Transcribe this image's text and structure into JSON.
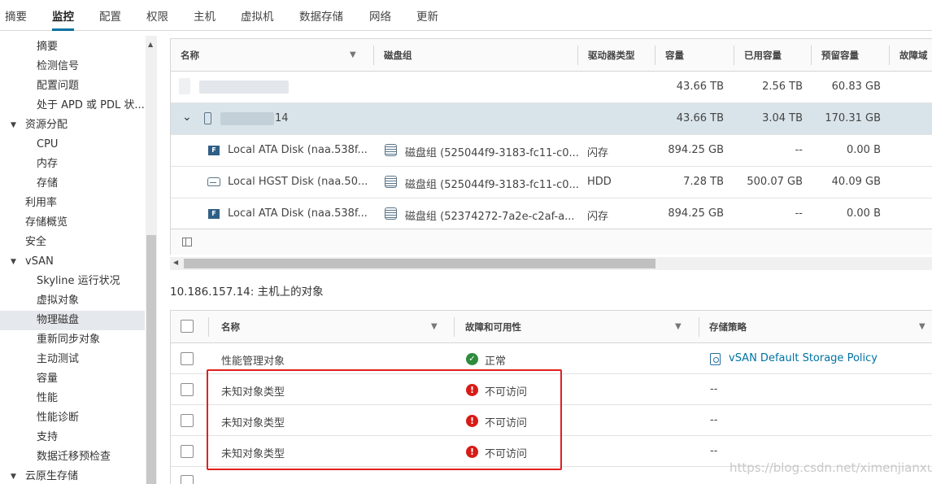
{
  "tabs": [
    "摘要",
    "监控",
    "配置",
    "权限",
    "主机",
    "虚拟机",
    "数据存储",
    "网络",
    "更新"
  ],
  "active_tab": "监控",
  "nav": {
    "items": [
      {
        "label": "摘要"
      },
      {
        "label": "检测信号"
      },
      {
        "label": "配置问题"
      },
      {
        "label": "处于 APD 或 PDL 状..."
      },
      {
        "label": "资源分配"
      },
      {
        "label": "CPU"
      },
      {
        "label": "内存"
      },
      {
        "label": "存储"
      },
      {
        "label": "利用率"
      },
      {
        "label": "存储概览"
      },
      {
        "label": "安全"
      },
      {
        "label": "vSAN"
      },
      {
        "label": "Skyline 运行状况"
      },
      {
        "label": "虚拟对象"
      },
      {
        "label": "物理磁盘"
      },
      {
        "label": "重新同步对象"
      },
      {
        "label": "主动测试"
      },
      {
        "label": "容量"
      },
      {
        "label": "性能"
      },
      {
        "label": "性能诊断"
      },
      {
        "label": "支持"
      },
      {
        "label": "数据迁移预检查"
      },
      {
        "label": "云原生存储"
      }
    ],
    "selected": "物理磁盘"
  },
  "disk_grid": {
    "headers": [
      "名称",
      "磁盘组",
      "驱动器类型",
      "容量",
      "已用容量",
      "预留容量",
      "故障域"
    ],
    "rows": [
      {
        "name": "",
        "group": "",
        "type": "",
        "capacity": "43.66 TB",
        "used": "2.56 TB",
        "reserved": "60.83 GB"
      },
      {
        "name": "14",
        "group": "",
        "type": "",
        "capacity": "43.66 TB",
        "used": "3.04 TB",
        "reserved": "170.31 GB"
      },
      {
        "name": "Local ATA Disk (naa.538f...",
        "group": "磁盘组 (525044f9-3183-fc11-c0...",
        "type": "闪存",
        "capacity": "894.25 GB",
        "used": "--",
        "reserved": "0.00 B",
        "icon": "F"
      },
      {
        "name": "Local HGST Disk (naa.50...",
        "group": "磁盘组 (525044f9-3183-fc11-c0...",
        "type": "HDD",
        "capacity": "7.28 TB",
        "used": "500.07 GB",
        "reserved": "40.09 GB"
      },
      {
        "name": "Local ATA Disk (naa.538f...",
        "group": "磁盘组 (52374272-7a2e-c2af-a...",
        "type": "闪存",
        "capacity": "894.25 GB",
        "used": "--",
        "reserved": "0.00 B",
        "icon": "F"
      }
    ]
  },
  "objects_section_title": "10.186.157.14: 主机上的对象",
  "objects_grid": {
    "headers": [
      "名称",
      "故障和可用性",
      "存储策略"
    ],
    "rows": [
      {
        "name": "性能管理对象",
        "status": "正常",
        "status_kind": "ok",
        "policy": "vSAN Default Storage Policy"
      },
      {
        "name": "未知对象类型",
        "status": "不可访问",
        "status_kind": "error",
        "policy": "--"
      },
      {
        "name": "未知对象类型",
        "status": "不可访问",
        "status_kind": "error",
        "policy": "--"
      },
      {
        "name": "未知对象类型",
        "status": "不可访问",
        "status_kind": "error",
        "policy": "--"
      }
    ]
  },
  "watermark": "https://blog.csdn.net/ximenjianxue",
  "colors": {
    "accent": "#0072a3",
    "selected_row": "#d9e4ea",
    "ok": "#2d8c3c",
    "error": "#d81b16",
    "highlight_box": "#e02020"
  }
}
